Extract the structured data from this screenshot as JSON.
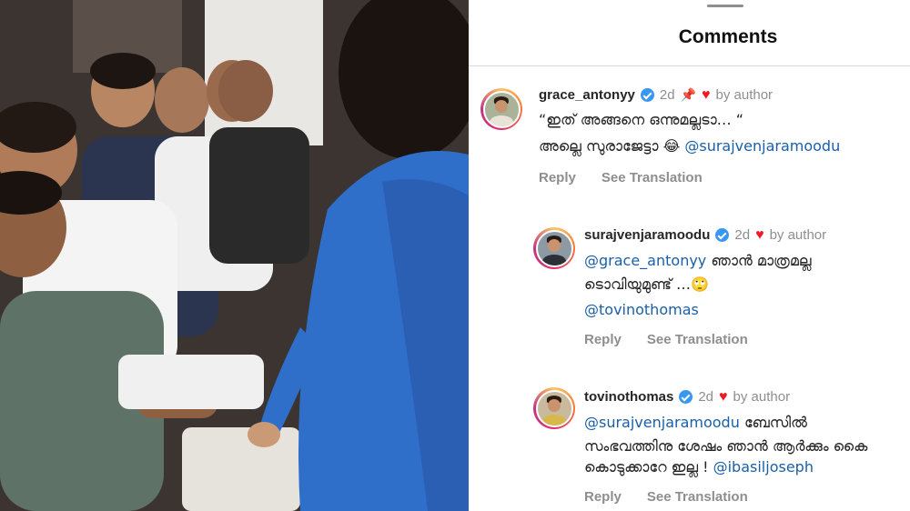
{
  "panel": {
    "title": "Comments"
  },
  "comments": [
    {
      "username": "grace_antonyy",
      "time": "2d",
      "pinned": true,
      "by_author": "by author",
      "line1": "“ഇത് അങ്ങനെ ഒന്നുമല്ലടാ… “",
      "line2_text": "അല്ലെ സുരാജേട്ടാ 😂 ",
      "line2_mention": "@surajvenjaramoodu",
      "reply": "Reply",
      "translate": "See Translation"
    },
    {
      "username": "surajvenjaramoodu",
      "time": "2d",
      "by_author": "by author",
      "line1_mention": "@grace_antonyy",
      "line1_text": " ഞാൻ മാത്രമല്ല",
      "line2": "ടൊവിയുമുണ്ട് …🙄",
      "line3_mention": "@tovinothomas",
      "reply": "Reply",
      "translate": "See Translation"
    },
    {
      "username": "tovinothomas",
      "time": "2d",
      "by_author": "by author",
      "line1_mention": "@surajvenjaramoodu",
      "line1_text": " ബേസിൽ",
      "line2": "സംഭവത്തിനു ശേഷം  ഞാൻ ആർക്കും കൈ",
      "line3_text": "കൊടുക്കാറേ ഇല്ല ! ",
      "line3_mention": "@ibasiljoseph",
      "reply": "Reply",
      "translate": "See Translation"
    }
  ],
  "icons": {
    "verified": "verified-badge-icon",
    "heart": "heart-icon",
    "pin": "pin-icon"
  },
  "colors": {
    "mention": "#1a5fa8",
    "verified": "#3897f0",
    "heart": "#ed1c24"
  }
}
